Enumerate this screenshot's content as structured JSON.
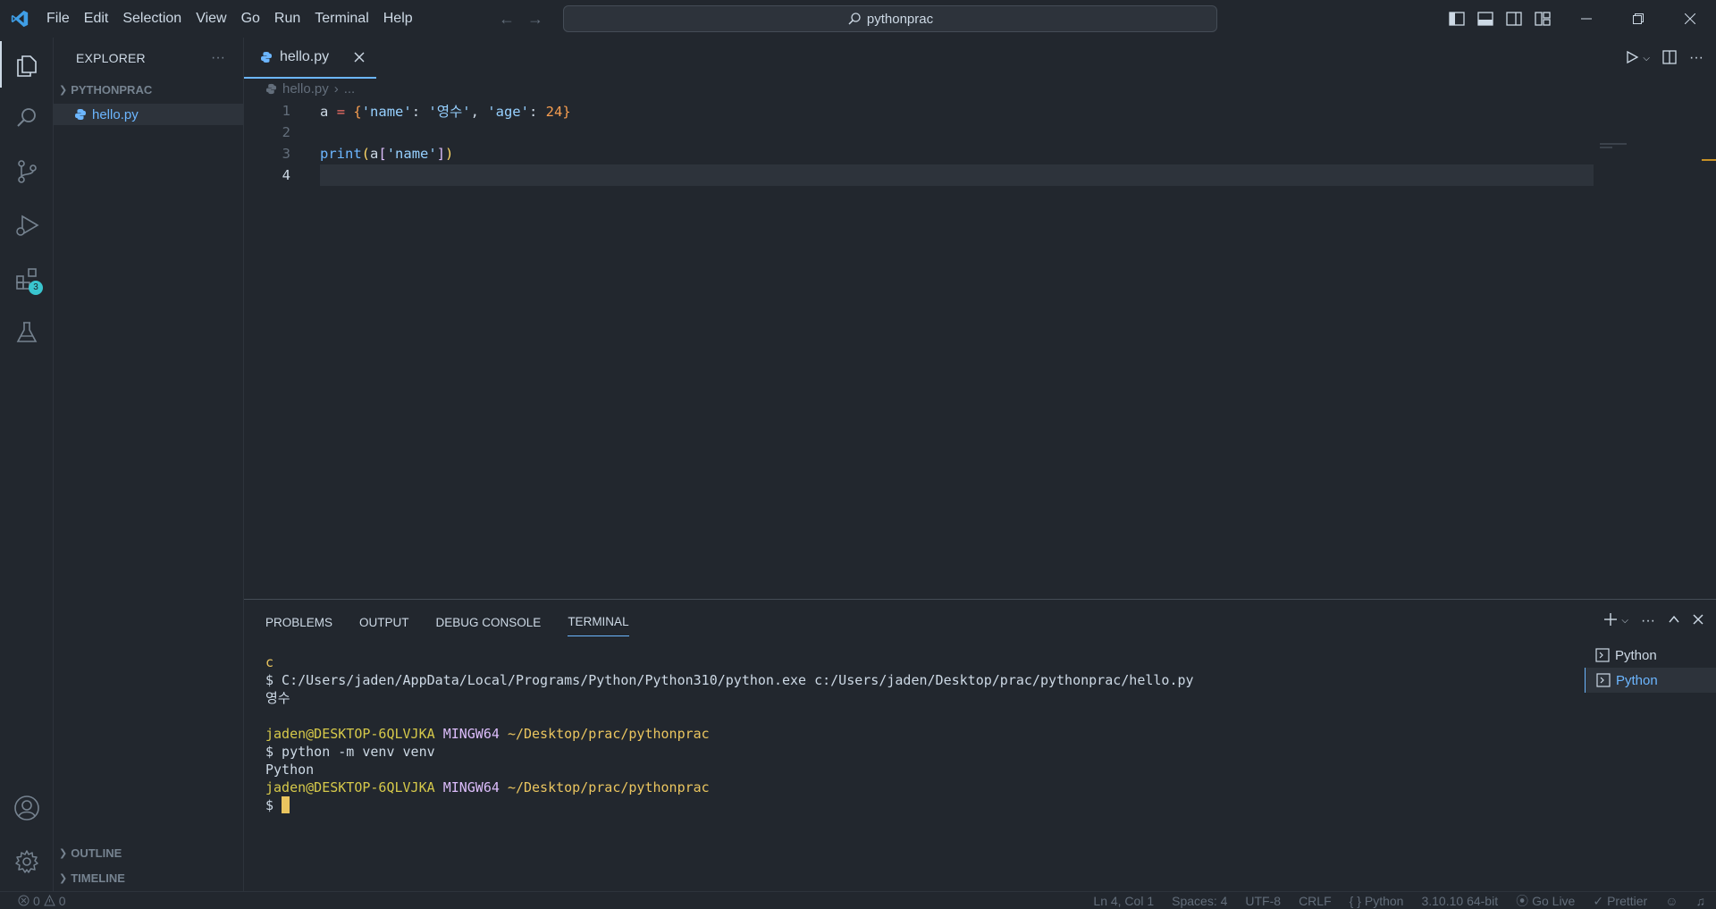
{
  "menu": [
    "File",
    "Edit",
    "Selection",
    "View",
    "Go",
    "Run",
    "Terminal",
    "Help"
  ],
  "command_center": {
    "text": "pythonprac"
  },
  "colors": {
    "accent": "#6cb6ff",
    "background": "#22272e",
    "badge": "#39c5cf",
    "cursor": "#eac55f"
  },
  "activity": {
    "extensions_badge": "3"
  },
  "sidebar": {
    "title": "EXPLORER",
    "more": "···",
    "folder": "PYTHONPRAC",
    "files": [
      "hello.py"
    ],
    "outline": "OUTLINE",
    "timeline": "TIMELINE"
  },
  "editor": {
    "tab": {
      "label": "hello.py"
    },
    "breadcrumb": {
      "file": "hello.py",
      "more": "..."
    },
    "line_numbers": [
      "1",
      "2",
      "3",
      "4"
    ],
    "lines": {
      "l1": {
        "var": "a",
        "op": "=",
        "open": "{",
        "k1": "'name'",
        "c1": ":",
        "v1": "'영수'",
        "sep": ",",
        "k2": "'age'",
        "c2": ":",
        "v2": "24",
        "close": "}"
      },
      "l3": {
        "fn": "print",
        "po": "(",
        "var": "a",
        "bo": "[",
        "key": "'name'",
        "bc": "]",
        "pc": ")"
      }
    }
  },
  "panel": {
    "tabs": [
      "PROBLEMS",
      "OUTPUT",
      "DEBUG CONSOLE",
      "TERMINAL"
    ],
    "terminal": {
      "l1": "c",
      "l2": "$ C:/Users/jaden/AppData/Local/Programs/Python/Python310/python.exe c:/Users/jaden/Desktop/prac/pythonprac/hello.py",
      "l3": "영수",
      "l5_user": "jaden@DESKTOP-6QLVJKA",
      "l5_env": "MINGW64",
      "l5_path": "~/Desktop/prac/pythonprac",
      "l6": "$ python -m venv venv",
      "l7": "Python",
      "l8_user": "jaden@DESKTOP-6QLVJKA",
      "l8_env": "MINGW64",
      "l8_path": "~/Desktop/prac/pythonprac",
      "prompt": "$ "
    },
    "terminal_list": [
      "Python",
      "Python"
    ]
  },
  "status": {
    "errors": "0",
    "warnings": "0",
    "position": "Ln 4, Col 1",
    "spaces": "Spaces: 4",
    "encoding": "UTF-8",
    "eol": "CRLF",
    "language": "Python",
    "interpreter": "3.10.10 64-bit",
    "golive": "Go Live",
    "prettier": "Prettier"
  }
}
